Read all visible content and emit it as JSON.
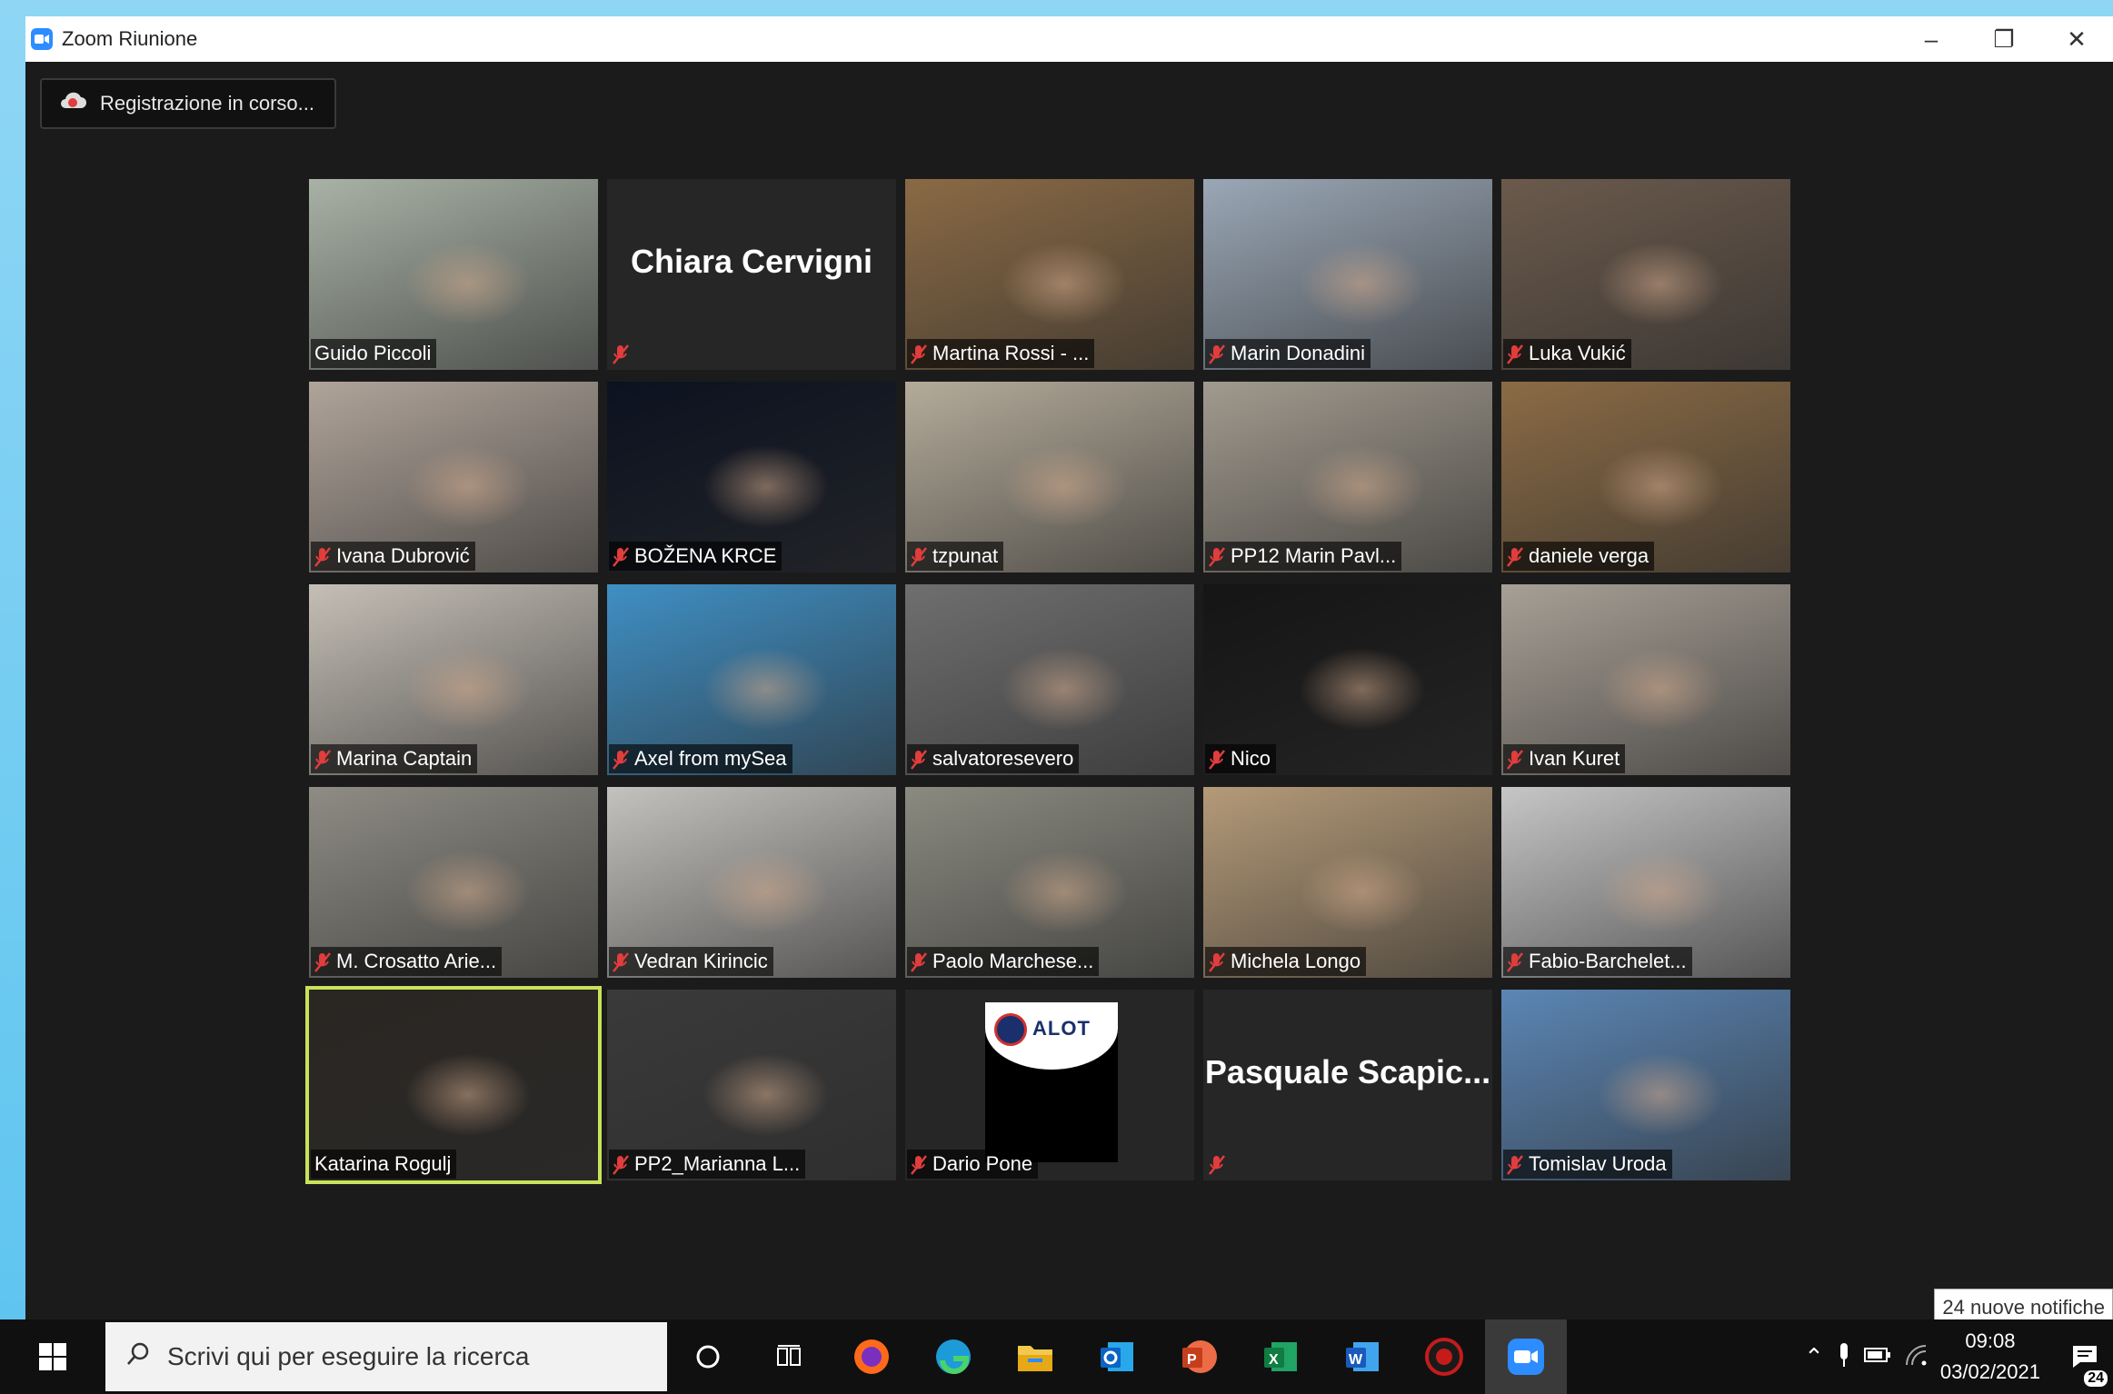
{
  "window": {
    "title": "Zoom Riunione",
    "controls": {
      "minimize": "–",
      "restore": "❐",
      "close": "✕"
    }
  },
  "recording": {
    "label": "Registrazione in corso..."
  },
  "participants": [
    {
      "name": "Guido Piccoli",
      "muted": false,
      "bg": "#a9b2a6"
    },
    {
      "name": "Chiara Cervigni",
      "muted": true,
      "video": false
    },
    {
      "name": "Martina Rossi - ...",
      "muted": true,
      "bg": "#8a6a45"
    },
    {
      "name": "Marin Donadini",
      "muted": true,
      "bg": "#9aa7b6"
    },
    {
      "name": "Luka Vukić",
      "muted": true,
      "bg": "#6b5a4c"
    },
    {
      "name": "Ivana Dubrović",
      "muted": true,
      "bg": "#b0a49a"
    },
    {
      "name": "BOŽENA KRCE",
      "muted": true,
      "bg": "#0c1220"
    },
    {
      "name": "tzpunat",
      "muted": true,
      "bg": "#b4ab9a"
    },
    {
      "name": "PP12 Marin Pavl...",
      "muted": true,
      "bg": "#a19a8e"
    },
    {
      "name": "daniele verga",
      "muted": true,
      "bg": "#8b6b45"
    },
    {
      "name": "Marina Captain",
      "muted": true,
      "bg": "#c5bfb6"
    },
    {
      "name": "Axel from mySea",
      "muted": true,
      "bg": "#3f8fc4"
    },
    {
      "name": "salvatoresevero",
      "muted": true,
      "bg": "#6f6f6f"
    },
    {
      "name": "Nico",
      "muted": true,
      "bg": "#151515"
    },
    {
      "name": "Ivan Kuret",
      "muted": true,
      "bg": "#a8a096"
    },
    {
      "name": "M. Crosatto Arie...",
      "muted": true,
      "bg": "#8e8c84"
    },
    {
      "name": "Vedran Kirincic",
      "muted": true,
      "bg": "#c4c2be"
    },
    {
      "name": "Paolo Marchese...",
      "muted": true,
      "bg": "#8b8a80"
    },
    {
      "name": "Michela Longo",
      "muted": true,
      "bg": "#b49a78"
    },
    {
      "name": "Fabio-Barchelet...",
      "muted": true,
      "bg": "#c6c6c6"
    },
    {
      "name": "Katarina Rogulj",
      "muted": false,
      "bg": "#2a2622",
      "active": true
    },
    {
      "name": "PP2_Marianna L...",
      "muted": true,
      "bg": "#3a3a3a"
    },
    {
      "name": "Dario Pone",
      "muted": true,
      "logo": "ALOT"
    },
    {
      "name": "Pasquale Scapic...",
      "muted": true,
      "video": false
    },
    {
      "name": "Tomislav Uroda",
      "muted": true,
      "bg": "#5b86b5"
    }
  ],
  "taskbar": {
    "search_placeholder": "Scrivi qui per eseguire la ricerca",
    "time": "09:08",
    "date": "03/02/2021",
    "notification_tip": "24 nuove notifiche",
    "notification_count": "24"
  },
  "colors": {
    "accent_active": "#c8e35a",
    "zoom_blue": "#2d8cff",
    "mute_red": "#e23d3d"
  }
}
